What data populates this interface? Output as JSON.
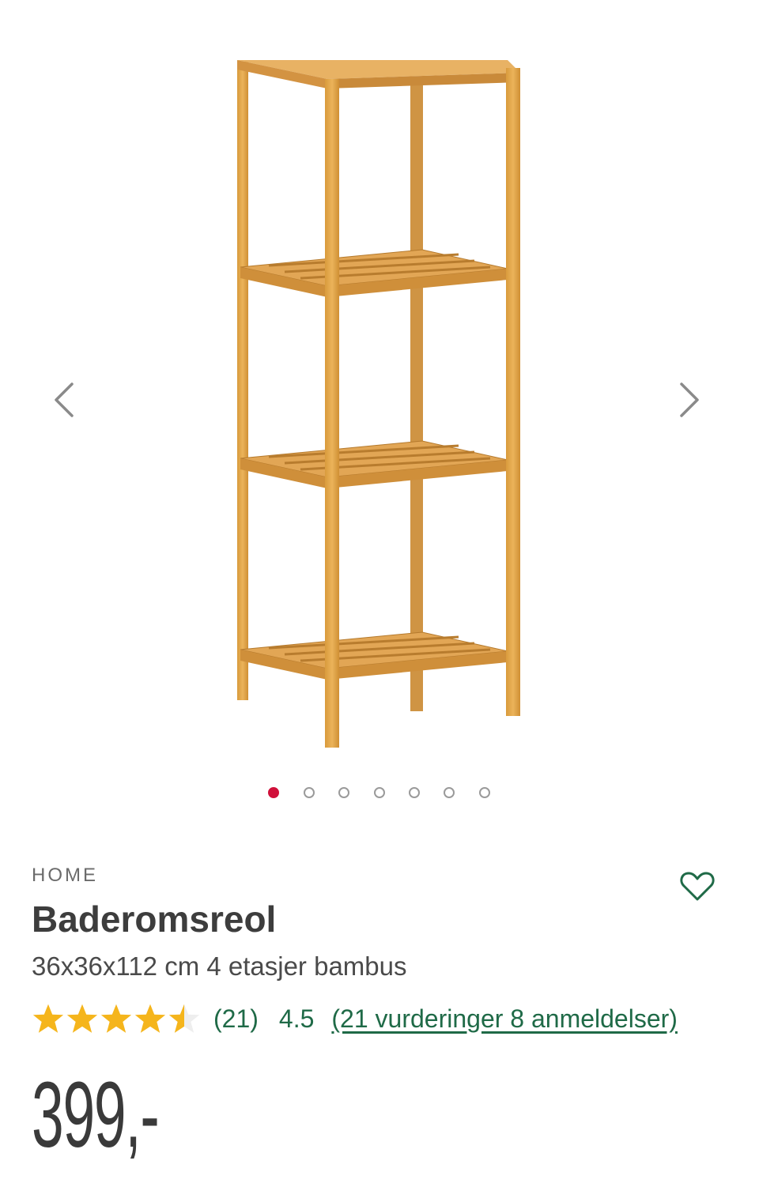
{
  "gallery": {
    "image_alt": "Baderomsreol",
    "prev_icon": "chevron-left-icon",
    "next_icon": "chevron-right-icon",
    "dot_count": 7,
    "active_dot": 0,
    "active_color": "#d0103a"
  },
  "product": {
    "brand": "HOME",
    "title": "Baderomsreol",
    "subtitle": "36x36x112 cm 4 etasjer bambus",
    "favorite_icon": "heart-outline-icon",
    "rating": {
      "stars": 4.5,
      "star_color": "#f5b51c",
      "count": "(21)",
      "value": "4.5",
      "link_text": "(21 vurderinger 8 anmeldelser)",
      "link_color": "#1f6a47"
    },
    "price": "399,-"
  }
}
